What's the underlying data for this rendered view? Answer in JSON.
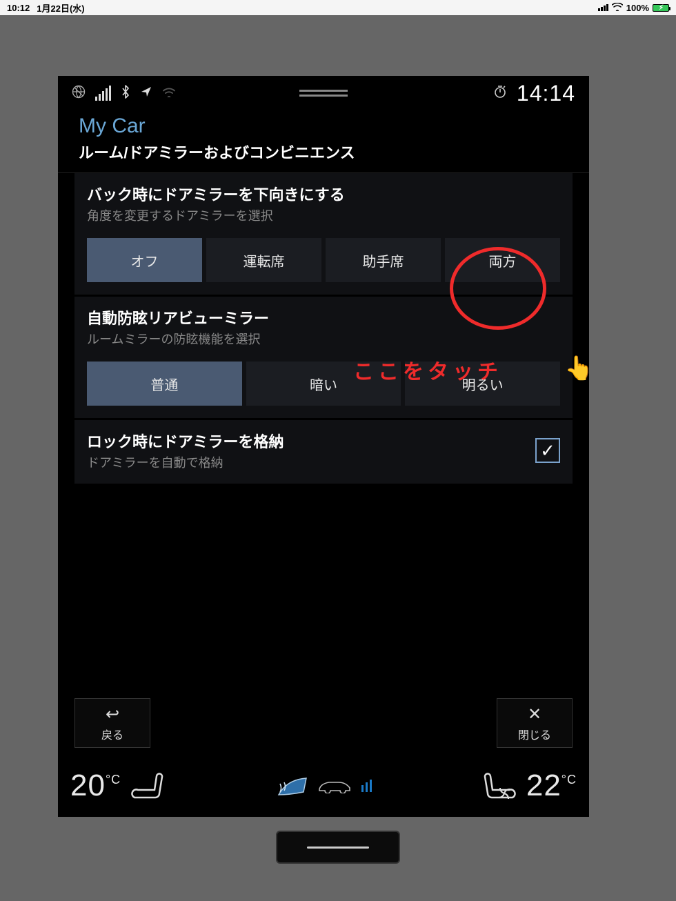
{
  "ipad_status": {
    "time": "10:12",
    "date": "1月22日(水)",
    "battery_pct": "100%"
  },
  "unit_status": {
    "clock": "14:14"
  },
  "header": {
    "app_title": "My Car",
    "section_title": "ルーム/ドアミラーおよびコンビニエンス"
  },
  "groups": {
    "mirror_tilt": {
      "title": "バック時にドアミラーを下向きにする",
      "subtitle": "角度を変更するドアミラーを選択",
      "options": [
        "オフ",
        "運転席",
        "助手席",
        "両方"
      ],
      "selected_index": 0
    },
    "auto_dim": {
      "title": "自動防眩リアビューミラー",
      "subtitle": "ルームミラーの防眩機能を選択",
      "options": [
        "普通",
        "暗い",
        "明るい"
      ],
      "selected_index": 0
    },
    "fold_on_lock": {
      "title": "ロック時にドアミラーを格納",
      "subtitle": "ドアミラーを自動で格納",
      "checked": true
    }
  },
  "nav": {
    "back": "戻る",
    "close": "閉じる"
  },
  "climate": {
    "temp_left": "20",
    "temp_right": "22",
    "deg_label": "°C"
  },
  "annotation": {
    "text": "ここをタッチ",
    "hand": "👆"
  }
}
